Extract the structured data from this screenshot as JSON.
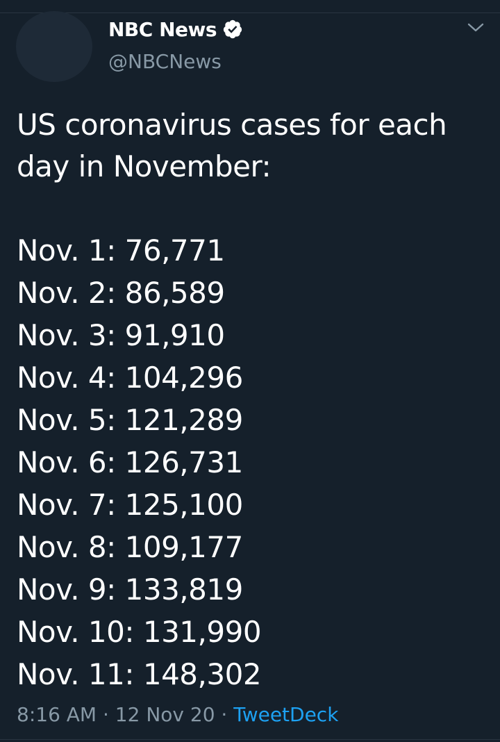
{
  "author": {
    "name": "NBC News",
    "handle": "@NBCNews",
    "verified": true
  },
  "tweet": {
    "intro": "US coronavirus cases for each day in November:",
    "lines": [
      "Nov. 1: 76,771",
      "Nov. 2: 86,589",
      "Nov. 3: 91,910",
      "Nov. 4: 104,296",
      "Nov. 5: 121,289",
      "Nov. 6: 126,731",
      "Nov. 7: 125,100",
      "Nov. 8: 109,177",
      "Nov. 9: 133,819",
      "Nov. 10: 131,990",
      "Nov. 11: 148,302"
    ]
  },
  "meta": {
    "time": "8:16 AM",
    "sep1": " · ",
    "date": "12 Nov 20",
    "sep2": " · ",
    "source": "TweetDeck"
  },
  "colors": {
    "background": "#15202b",
    "text": "#ffffff",
    "secondary": "#8899a6",
    "link": "#1da1f2"
  },
  "icons": {
    "verified": "verified-badge-icon",
    "caret": "chevron-down-icon"
  }
}
